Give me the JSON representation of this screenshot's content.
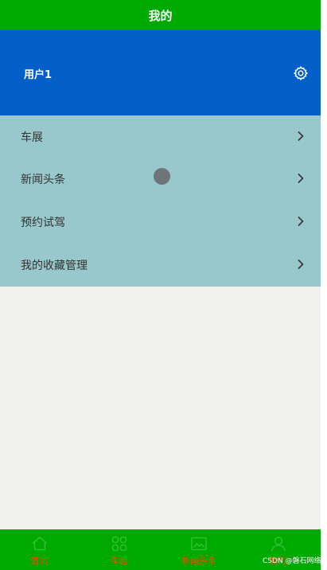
{
  "header": {
    "title": "我的"
  },
  "profile": {
    "username": "用户1"
  },
  "menu": {
    "items": [
      {
        "label": "车展"
      },
      {
        "label": "新闻头条"
      },
      {
        "label": "预约试驾"
      },
      {
        "label": "我的收藏管理"
      }
    ]
  },
  "tabbar": {
    "tabs": [
      {
        "label": "首页",
        "icon": "home-icon"
      },
      {
        "label": "车展",
        "icon": "grid-icon"
      },
      {
        "label": "新闻头条",
        "icon": "news-icon"
      },
      {
        "label": "我的",
        "icon": "user-icon"
      }
    ]
  },
  "watermark": "CSDN @磐石网络",
  "colors": {
    "header_bg": "#00a900",
    "profile_bg": "#0460c8",
    "menu_bg": "#98c7cc",
    "tab_label": "#d25c00",
    "page_bg": "#f0f0ef"
  }
}
